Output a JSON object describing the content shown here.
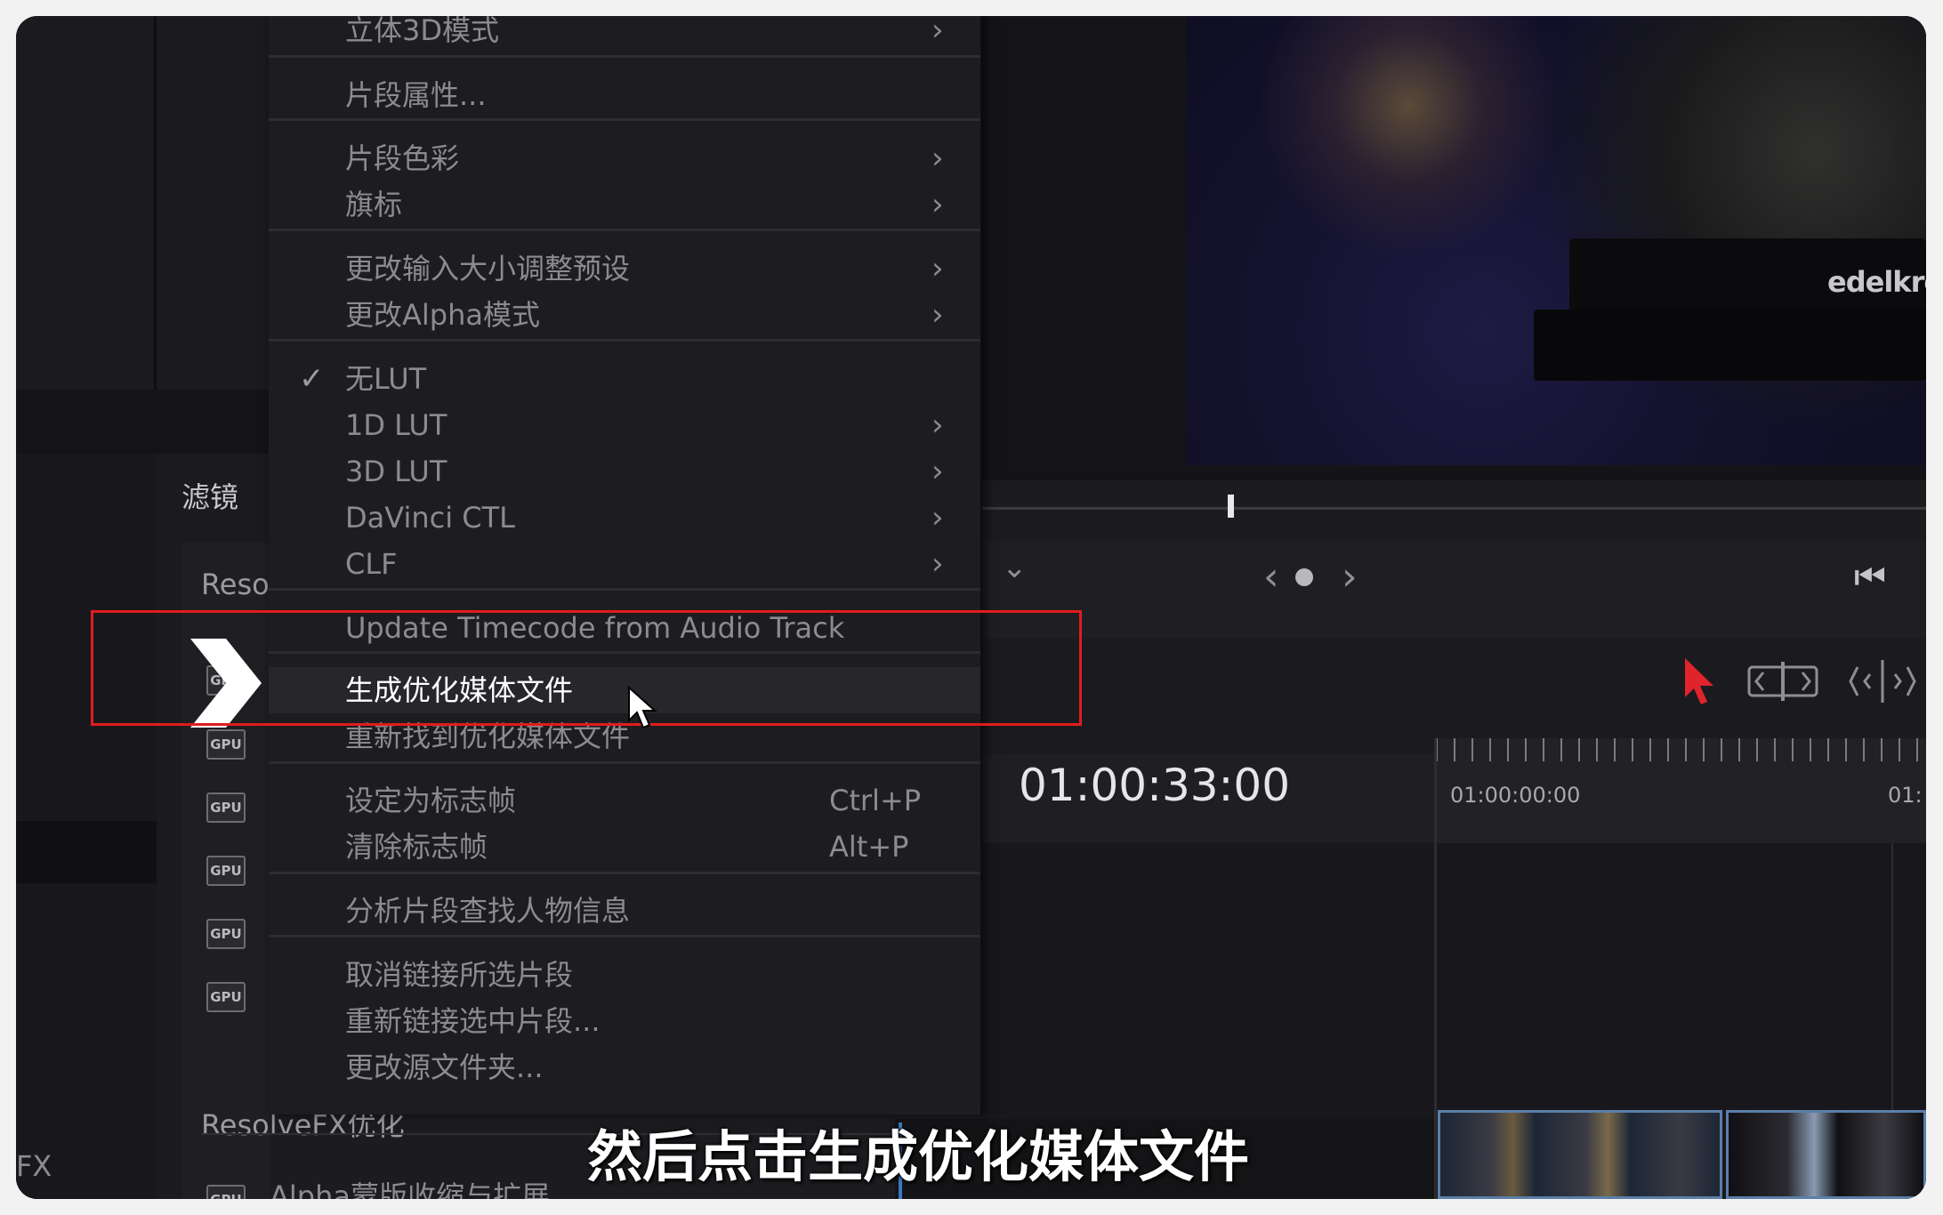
{
  "left_panel": {
    "filters_label": "滤镜",
    "section_reso": "Reso",
    "section_resolvefx": "ResolveFX优化",
    "bottom_item": "Alpha蒙版收缩与扩展",
    "fx_label": "FX",
    "gpu_badge": "GPU"
  },
  "context_menu": {
    "items": [
      {
        "label": "立体3D模式",
        "arrow": "›"
      },
      {
        "label": "片段属性..."
      },
      {
        "label": "片段色彩",
        "arrow": "›"
      },
      {
        "label": "旗标",
        "arrow": "›"
      },
      {
        "label": "更改输入大小调整预设",
        "arrow": "›"
      },
      {
        "label": "更改Alpha模式",
        "arrow": "›"
      },
      {
        "label": "无LUT",
        "check": "✓"
      },
      {
        "label": "1D LUT",
        "arrow": "›"
      },
      {
        "label": "3D LUT",
        "arrow": "›"
      },
      {
        "label": "DaVinci CTL",
        "arrow": "›"
      },
      {
        "label": "CLF",
        "arrow": "›"
      },
      {
        "label": "Update Timecode from Audio Track"
      },
      {
        "label": "生成优化媒体文件"
      },
      {
        "label": "重新找到优化媒体文件"
      },
      {
        "label": "设定为标志帧",
        "shortcut": "Ctrl+P"
      },
      {
        "label": "清除标志帧",
        "shortcut": "Alt+P"
      },
      {
        "label": "分析片段查找人物信息"
      },
      {
        "label": "取消链接所选片段"
      },
      {
        "label": "重新链接选中片段..."
      },
      {
        "label": "更改源文件夹..."
      }
    ]
  },
  "viewer": {
    "brand_text": "edelkron",
    "nav_prev": "‹",
    "nav_next": "›",
    "chevron": "⌄",
    "skip_start": "⏮"
  },
  "timeline": {
    "timecode": "01:00:33:00",
    "ruler_start": "01:00:00:00",
    "ruler_next": "01:"
  },
  "subtitle": "然后点击生成优化媒体文件",
  "colors": {
    "highlight_box": "#e01c1c",
    "select_tool": "#e0242c",
    "background": "#1c1c20"
  }
}
